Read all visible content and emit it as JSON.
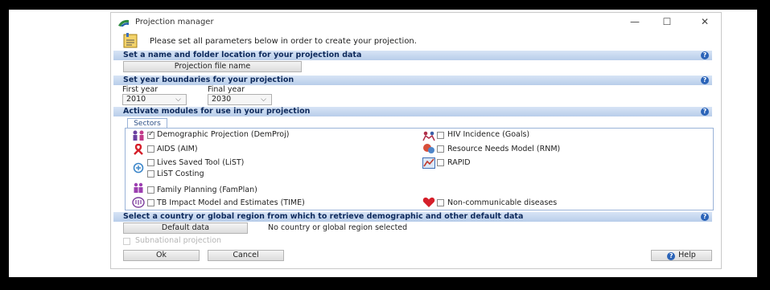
{
  "window": {
    "title": "Projection manager",
    "controls": {
      "minimize": "—",
      "maximize": "☐",
      "close": "✕"
    }
  },
  "intro": "Please set all parameters below in order to create your projection.",
  "sections": {
    "name": "Set a name and folder location for your projection data",
    "years": "Set year boundaries for your projection",
    "modules": "Activate modules for use in your projection",
    "country": "Select a country or global region from which to retrieve demographic and other default data"
  },
  "help_glyph": "?",
  "projection_button": "Projection file name",
  "years": {
    "first_label": "First year",
    "final_label": "Final year",
    "first_value": "2010",
    "final_value": "2030",
    "chevron": "⌵"
  },
  "tab": "Sectors",
  "modules_left": [
    {
      "label": "Demographic Projection (DemProj)",
      "checked": true
    },
    {
      "label": "AIDS (AIM)",
      "checked": false
    },
    {
      "label": "Lives Saved Tool (LiST)",
      "checked": false
    },
    {
      "label": "LiST Costing",
      "checked": false
    },
    {
      "label": "Family Planning (FamPlan)",
      "checked": false
    },
    {
      "label": "TB Impact Model and Estimates (TIME)",
      "checked": false
    }
  ],
  "modules_right": [
    {
      "label": "HIV Incidence (Goals)",
      "checked": false
    },
    {
      "label": "Resource Needs Model (RNM)",
      "checked": false
    },
    {
      "label": "RAPID",
      "checked": false
    },
    {
      "label": "Non-communicable diseases",
      "checked": false
    }
  ],
  "default_data_button": "Default data",
  "country_status": "No country or global region selected",
  "subnational": "Subnational projection",
  "buttons": {
    "ok": "Ok",
    "cancel": "Cancel",
    "help": "Help"
  },
  "colors": {
    "section_text": "#0e2a5c",
    "help_blue": "#2a63b8",
    "arrow": "#c8504a"
  }
}
